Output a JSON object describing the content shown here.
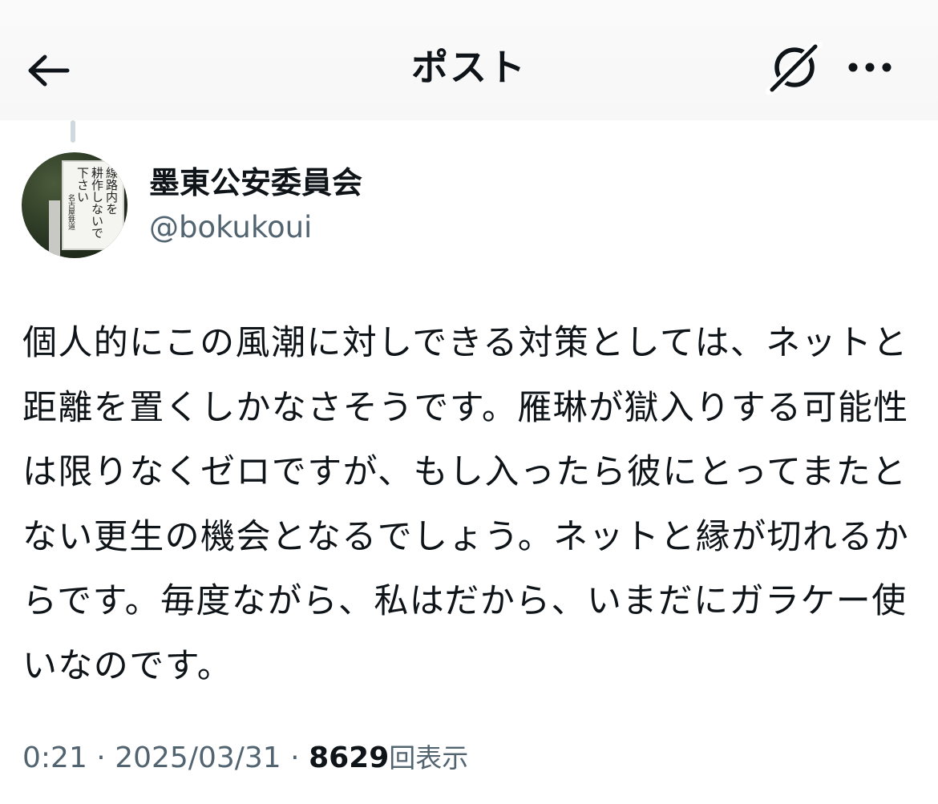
{
  "header": {
    "title": "ポスト",
    "back_icon": "arrow-left-icon",
    "grok_icon": "grok-icon",
    "more_icon": "more-horizontal-icon"
  },
  "author": {
    "display_name": "墨東公安委員会",
    "handle": "@bokukoui",
    "avatar_sign_lines": [
      "線路内を",
      "耕作しないで",
      "下さい",
      "名古屋鉄道"
    ]
  },
  "post": {
    "text": "個人的にこの風潮に対しできる対策としては、ネットと距離を置くしかなさそうです。雁琳が獄入りする可能性は限りなくゼロですが、もし入ったら彼にとってまたとない更生の機会となるでしょう。ネットと縁が切れるからです。毎度ながら、私はだから、いまだにガラケー使いなのです。",
    "time": "0:21",
    "date": "2025/03/31",
    "views": "8629",
    "views_label": "回表示",
    "separator": "·"
  }
}
